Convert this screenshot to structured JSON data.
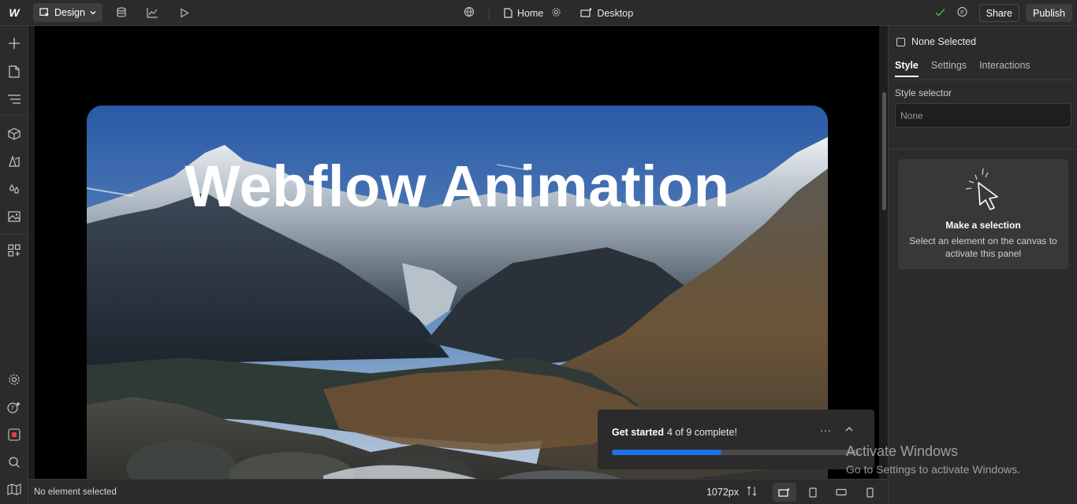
{
  "topbar": {
    "logo": "W",
    "mode_label": "Design",
    "page_label": "Home",
    "breakpoint_label": "Desktop",
    "share_label": "Share",
    "publish_label": "Publish"
  },
  "canvas": {
    "hero_title": "Webflow Animation"
  },
  "toast": {
    "title": "Get started",
    "count": "4 of 9 complete!",
    "more": "···",
    "progress_fraction": 0.44
  },
  "bottombar": {
    "status": "No element selected",
    "width_value": "1072px"
  },
  "rightpanel": {
    "selection": "None Selected",
    "tabs": [
      {
        "label": "Style"
      },
      {
        "label": "Settings"
      },
      {
        "label": "Interactions"
      }
    ],
    "style_selector_label": "Style selector",
    "style_selector_value": "None",
    "empty_title": "Make a selection",
    "empty_desc": "Select an element on the canvas to activate this panel"
  },
  "watermark": {
    "title": "Activate Windows",
    "subtitle": "Go to Settings to activate Windows."
  },
  "colors": {
    "accent": "#1a73e8",
    "panel": "#2b2b2b",
    "success": "#4caf50"
  }
}
